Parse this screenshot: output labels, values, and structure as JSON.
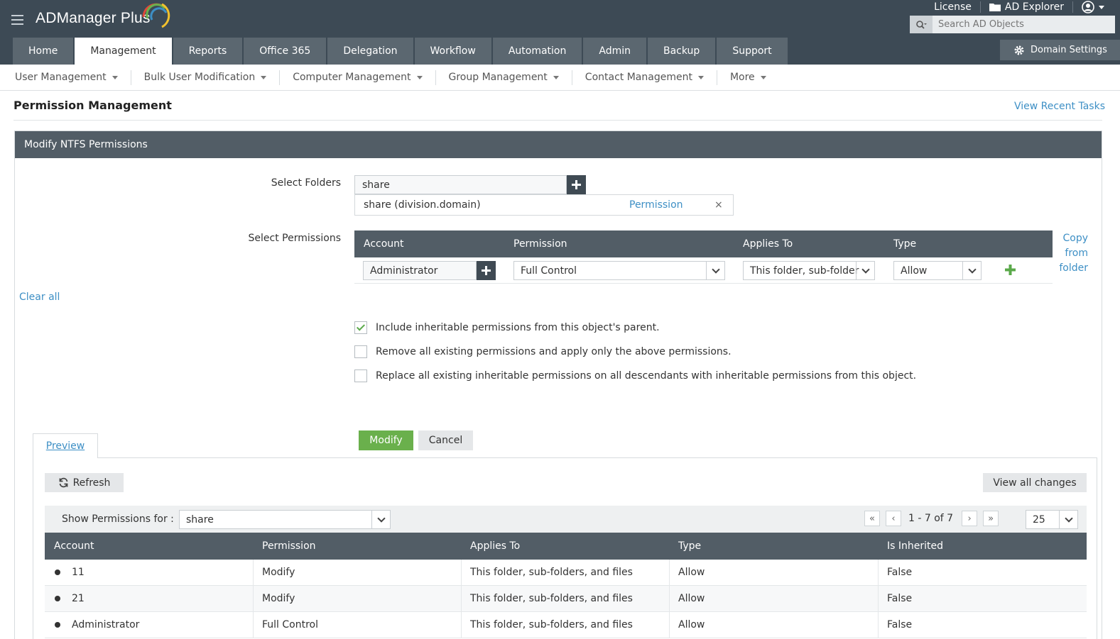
{
  "header": {
    "logo": "ADManager Plus",
    "links": [
      "License",
      "AD Explorer"
    ],
    "search_placeholder": "Search AD Objects",
    "domain_settings": "Domain Settings",
    "tabs": [
      "Home",
      "Management",
      "Reports",
      "Office 365",
      "Delegation",
      "Workflow",
      "Automation",
      "Admin",
      "Backup",
      "Support"
    ],
    "active_tab": "Management"
  },
  "subnav": [
    "User Management",
    "Bulk User Modification",
    "Computer Management",
    "Group Management",
    "Contact Management",
    "More"
  ],
  "page": {
    "title": "Permission Management",
    "recent_tasks": "View Recent Tasks"
  },
  "panel": {
    "title": "Modify NTFS Permissions",
    "select_folders_label": "Select Folders",
    "folder_input": "share",
    "selected_folder": "share (division.domain)",
    "permission_link": "Permission",
    "remove": "×",
    "select_permissions_label": "Select Permissions",
    "perm_headers": [
      "Account",
      "Permission",
      "Applies To",
      "Type"
    ],
    "perm_row": {
      "account": "Administrator",
      "permission": "Full Control",
      "applies_to": "This folder, sub-folder",
      "type": "Allow"
    },
    "copy_from_folder": [
      "Copy",
      "from",
      "folder"
    ],
    "clear_all": "Clear all",
    "options": [
      {
        "label": "Include inheritable permissions from this object's parent.",
        "checked": true
      },
      {
        "label": "Remove all existing permissions and apply only the above permissions.",
        "checked": false
      },
      {
        "label": "Replace all existing inheritable permissions on all descendants with inheritable permissions from this object.",
        "checked": false
      }
    ],
    "modify_button": "Modify",
    "cancel_button": "Cancel"
  },
  "preview": {
    "tab": "Preview",
    "refresh": "Refresh",
    "view_all_changes": "View all changes",
    "show_for_label": "Show Permissions for :",
    "show_for_value": "share",
    "pager_text": "1 - 7 of  7",
    "page_size": "25",
    "headers": [
      "Account",
      "Permission",
      "Applies To",
      "Type",
      "Is Inherited"
    ],
    "rows": [
      [
        "11",
        "Modify",
        "This folder, sub-folders, and files",
        "Allow",
        "False"
      ],
      [
        "21",
        "Modify",
        "This folder, sub-folders, and files",
        "Allow",
        "False"
      ],
      [
        "Administrator",
        "Full Control",
        "This folder, sub-folders, and files",
        "Allow",
        "False"
      ]
    ]
  },
  "colors": {
    "header_bg": "#3d4a55",
    "tab_bg": "#5b6770",
    "panel_head": "#525d66",
    "link": "#3d8fc5",
    "accent_green": "#6ab04c"
  }
}
